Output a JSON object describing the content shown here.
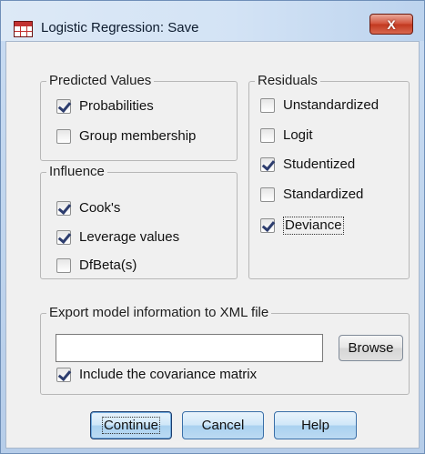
{
  "window": {
    "title": "Logistic Regression: Save",
    "close_label": "X"
  },
  "predicted": {
    "legend": "Predicted Values",
    "items": [
      {
        "label": "Probabilities",
        "checked": true
      },
      {
        "label": "Group membership",
        "checked": false
      }
    ]
  },
  "influence": {
    "legend": "Influence",
    "items": [
      {
        "label": "Cook's",
        "checked": true
      },
      {
        "label": "Leverage values",
        "checked": true
      },
      {
        "label": "DfBeta(s)",
        "checked": false
      }
    ]
  },
  "residuals": {
    "legend": "Residuals",
    "items": [
      {
        "label": "Unstandardized",
        "checked": false
      },
      {
        "label": "Logit",
        "checked": false
      },
      {
        "label": "Studentized",
        "checked": true
      },
      {
        "label": "Standardized",
        "checked": false
      },
      {
        "label": "Deviance",
        "checked": true
      }
    ]
  },
  "export": {
    "legend": "Export model information to XML file",
    "path_value": "",
    "browse_label": "Browse",
    "covariance": {
      "label": "Include the covariance matrix",
      "checked": true
    }
  },
  "buttons": {
    "continue": "Continue",
    "cancel": "Cancel",
    "help": "Help"
  }
}
